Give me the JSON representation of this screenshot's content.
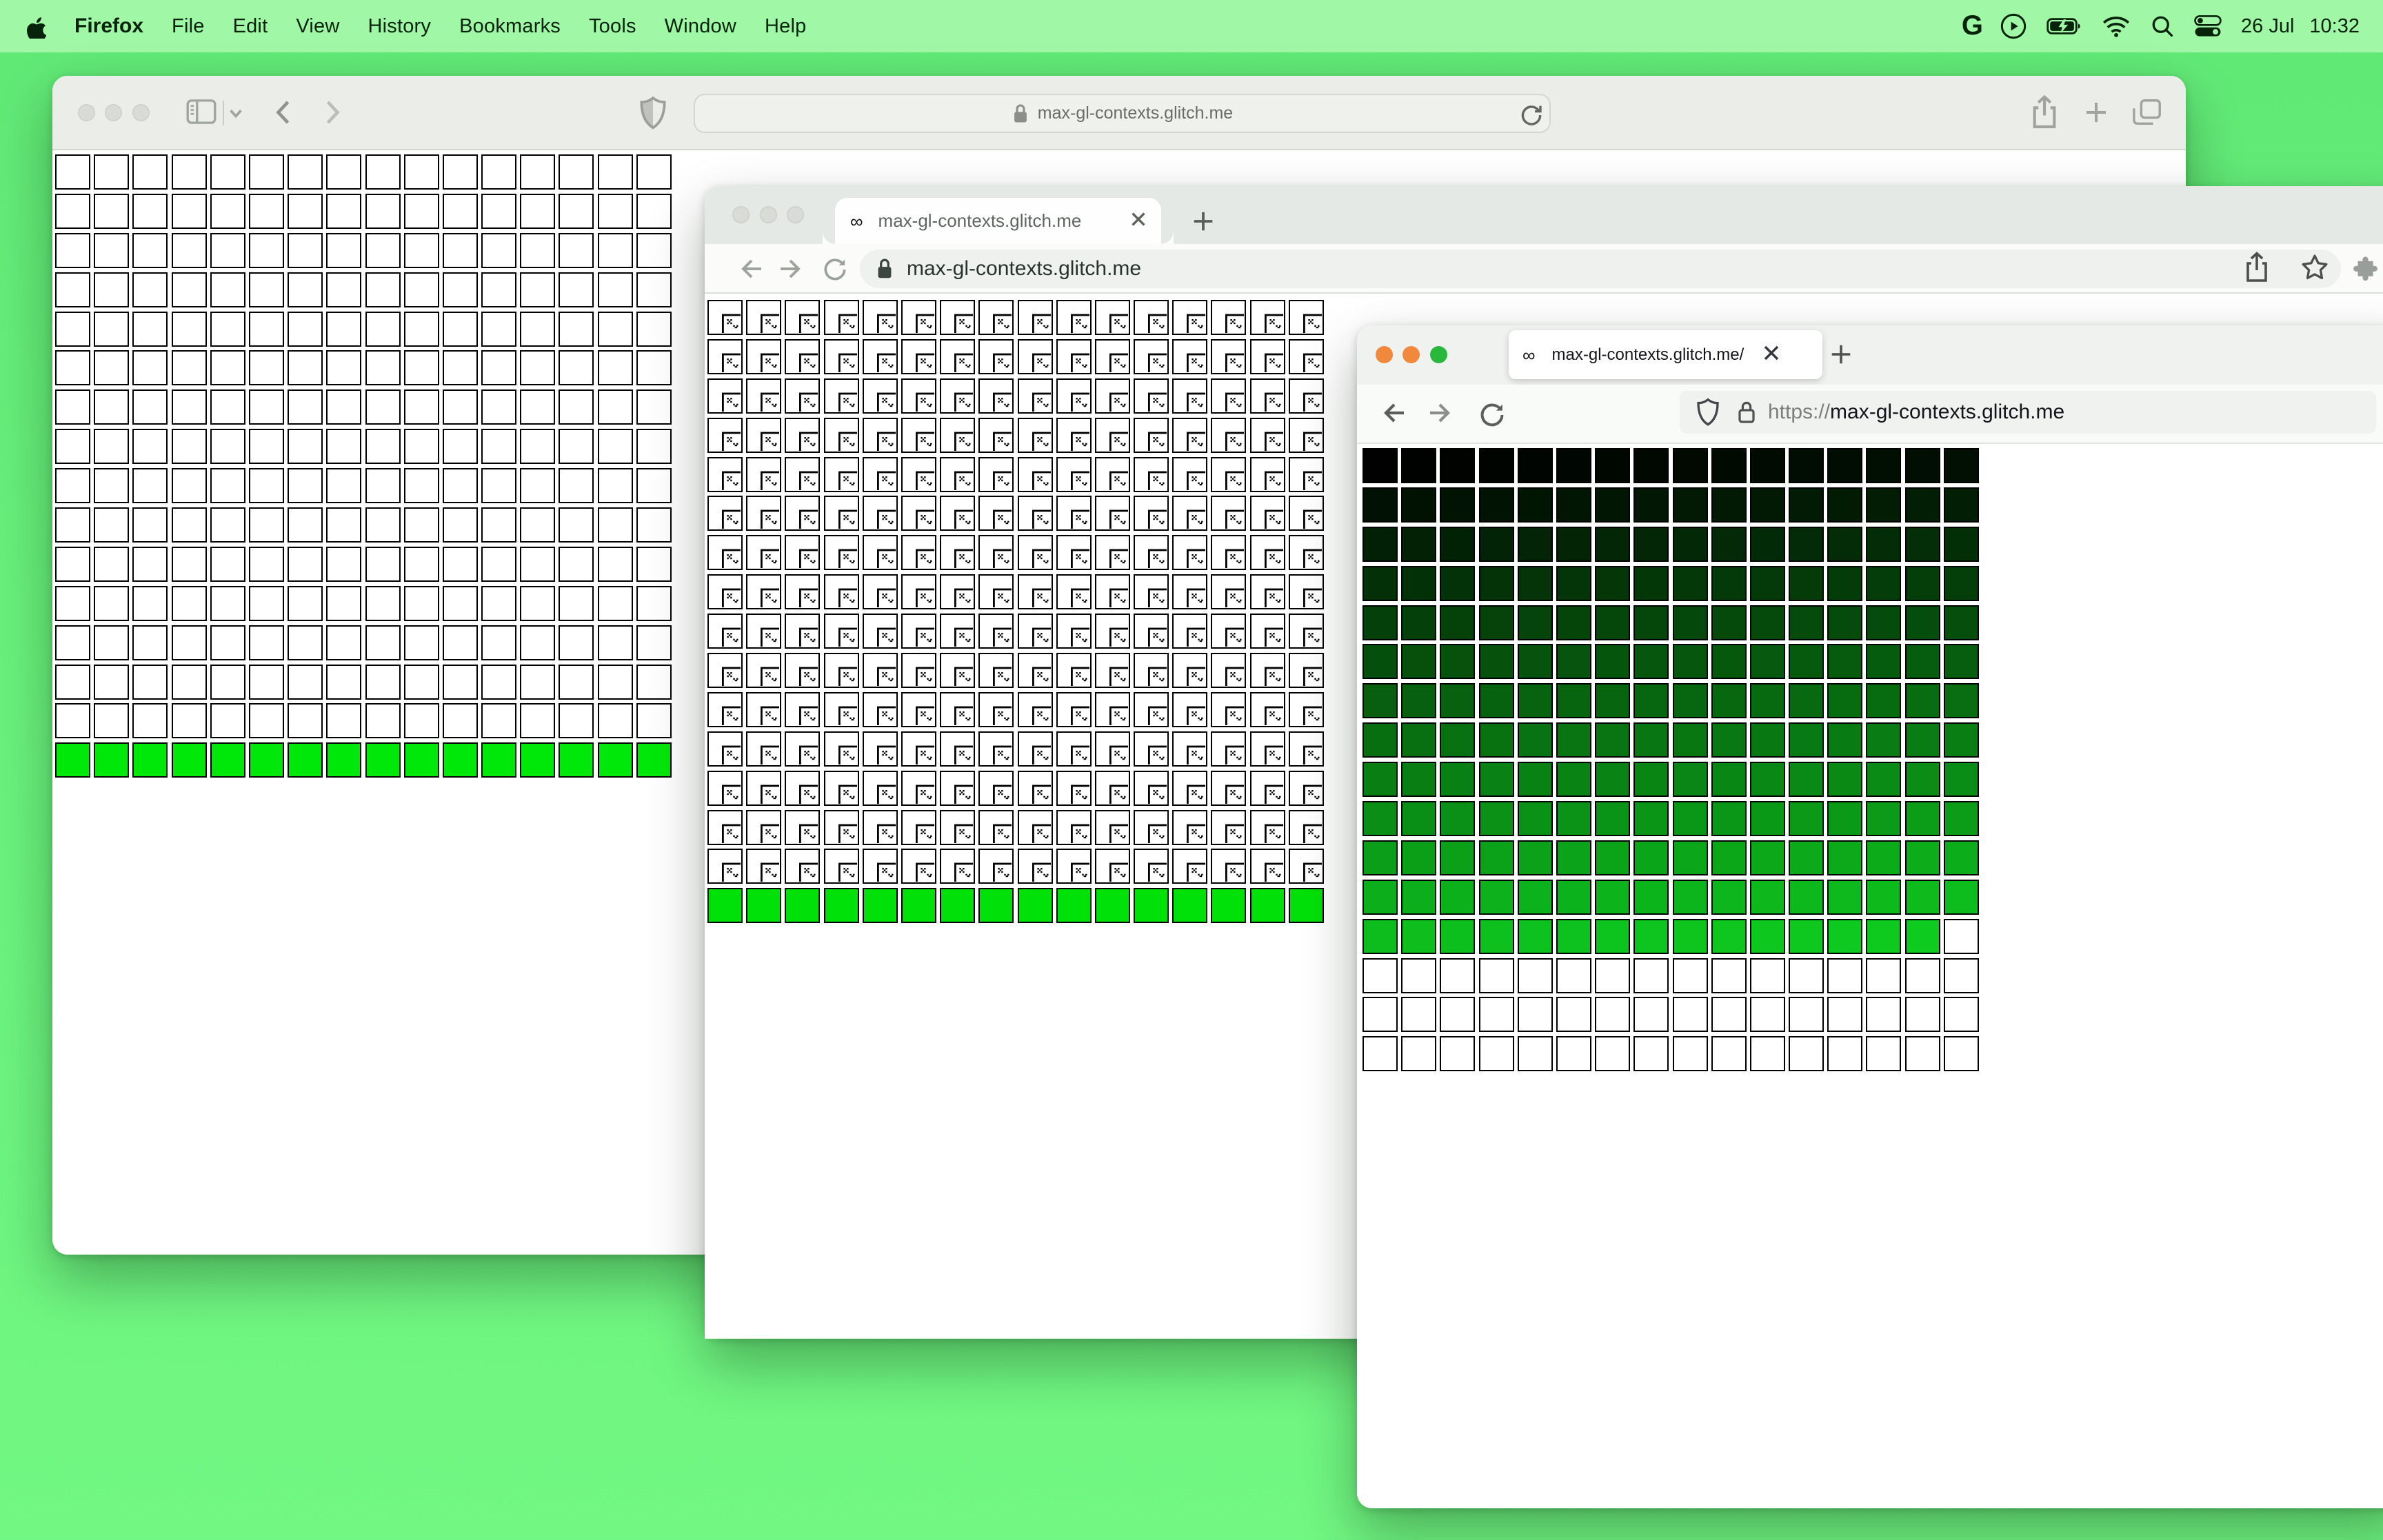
{
  "menubar": {
    "apple_icon": "apple-logo",
    "app_name": "Firefox",
    "menus": [
      "File",
      "Edit",
      "View",
      "History",
      "Bookmarks",
      "Tools",
      "Window",
      "Help"
    ],
    "status_g": "G",
    "status_icons": [
      "play-circle-icon",
      "battery-charging-icon",
      "wifi-icon",
      "search-icon",
      "control-center-icon"
    ],
    "date": "26 Jul",
    "time": "10:32"
  },
  "colors": {
    "desktop": "#5ce974",
    "menubar": "#9ef9a4",
    "safari_green": "#00e70a",
    "chrome_green": "#00e009",
    "firefox_gradient_end": "#0ecb1f",
    "firefox_traffic": [
      "#f0893e",
      "#f0893e",
      "#2ab83c"
    ]
  },
  "safari": {
    "url": "max-gl-contexts.glitch.me",
    "toolbar_icons": [
      "sidebar-icon",
      "chevron-down-icon",
      "back-icon",
      "forward-icon",
      "shield-icon",
      "lock-icon",
      "reload-icon",
      "share-icon",
      "plus-icon",
      "tabs-icon"
    ],
    "grid": {
      "cols": 16,
      "rows": 16,
      "plain_white_cells": 240,
      "green_cells": 16,
      "green_color": "#00e70a"
    }
  },
  "chrome": {
    "tab_title": "max-gl-contexts.glitch.me",
    "tab_favicon": "∞",
    "url": "max-gl-contexts.glitch.me",
    "grid": {
      "cols": 16,
      "rows": 16,
      "broken_cells": 240,
      "green_cells": 16,
      "green_color": "#00e009"
    }
  },
  "firefox": {
    "tab_title": "max-gl-contexts.glitch.me/",
    "tab_favicon": "∞",
    "url_scheme": "https://",
    "url_host": "max-gl-contexts.glitch.me",
    "grid": {
      "cols": 16,
      "rows": 16,
      "colored_cells": 207,
      "white_cells": 49,
      "start_rgb": [
        0,
        0,
        0
      ],
      "end_rgb": [
        14,
        203,
        31
      ]
    }
  }
}
